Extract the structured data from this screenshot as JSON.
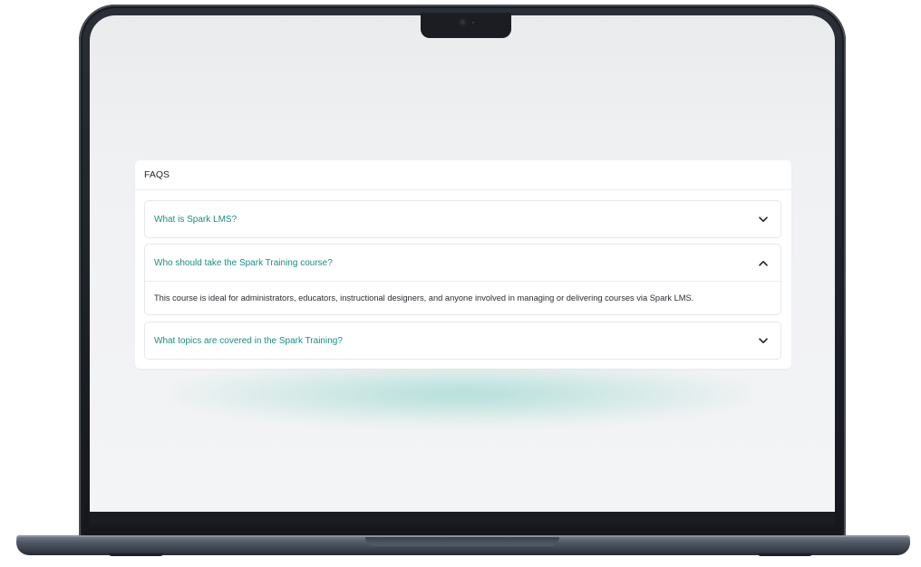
{
  "faq": {
    "title": "FAQS",
    "items": [
      {
        "question": "What is Spark LMS?",
        "expanded": false,
        "icon": "chevron-down-icon"
      },
      {
        "question": "Who should take the Spark Training course?",
        "expanded": true,
        "icon": "chevron-up-icon",
        "answer": "This course is ideal for administrators, educators, instructional designers, and anyone involved in managing or delivering courses via Spark LMS."
      },
      {
        "question": "What topics are covered in the Spark Training?",
        "expanded": false,
        "icon": "chevron-down-icon"
      }
    ]
  },
  "colors": {
    "accent": "#1a8f83",
    "glow": "#7ecdc4",
    "screen_bg": "#f0f1f3",
    "laptop_frame": "#1d2027"
  }
}
